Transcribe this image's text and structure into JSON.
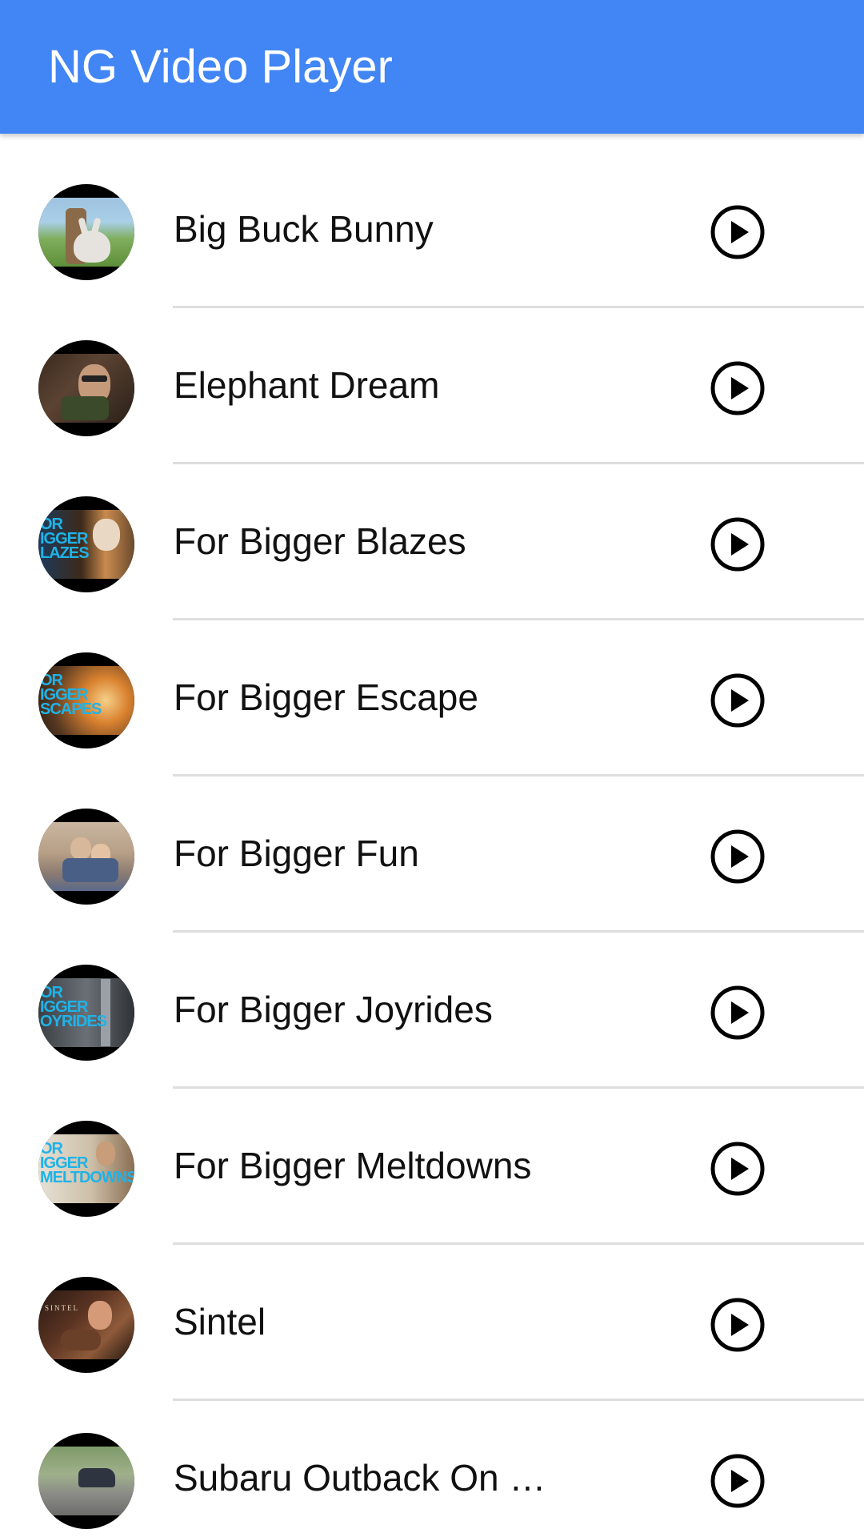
{
  "app_bar": {
    "title": "NG Video Player",
    "color": "#4285f4"
  },
  "videos": [
    {
      "title": "Big Buck Bunny",
      "thumb_style": "bunny"
    },
    {
      "title": "Elephant Dream",
      "thumb_style": "elephant"
    },
    {
      "title": "For Bigger Blazes",
      "thumb_style": "blazes",
      "thumb_text": "OR\nIGGER\nLAZES"
    },
    {
      "title": "For Bigger Escape",
      "thumb_style": "escape",
      "thumb_text": "OR\nIGGER\nSCAPES"
    },
    {
      "title": "For Bigger Fun",
      "thumb_style": "fun"
    },
    {
      "title": "For Bigger Joyrides",
      "thumb_style": "joyrides",
      "thumb_text": "OR\nIGGER\nOYRIDES"
    },
    {
      "title": "For Bigger Meltdowns",
      "thumb_style": "meltdowns",
      "thumb_text": "OR\nIGGER\nMELTDOWNS"
    },
    {
      "title": "Sintel",
      "thumb_style": "sintel",
      "thumb_text": "SINTEL"
    },
    {
      "title": "Subaru Outback On …",
      "thumb_style": "subaru"
    }
  ],
  "icons": {
    "play": "play-circle-outline-icon"
  }
}
